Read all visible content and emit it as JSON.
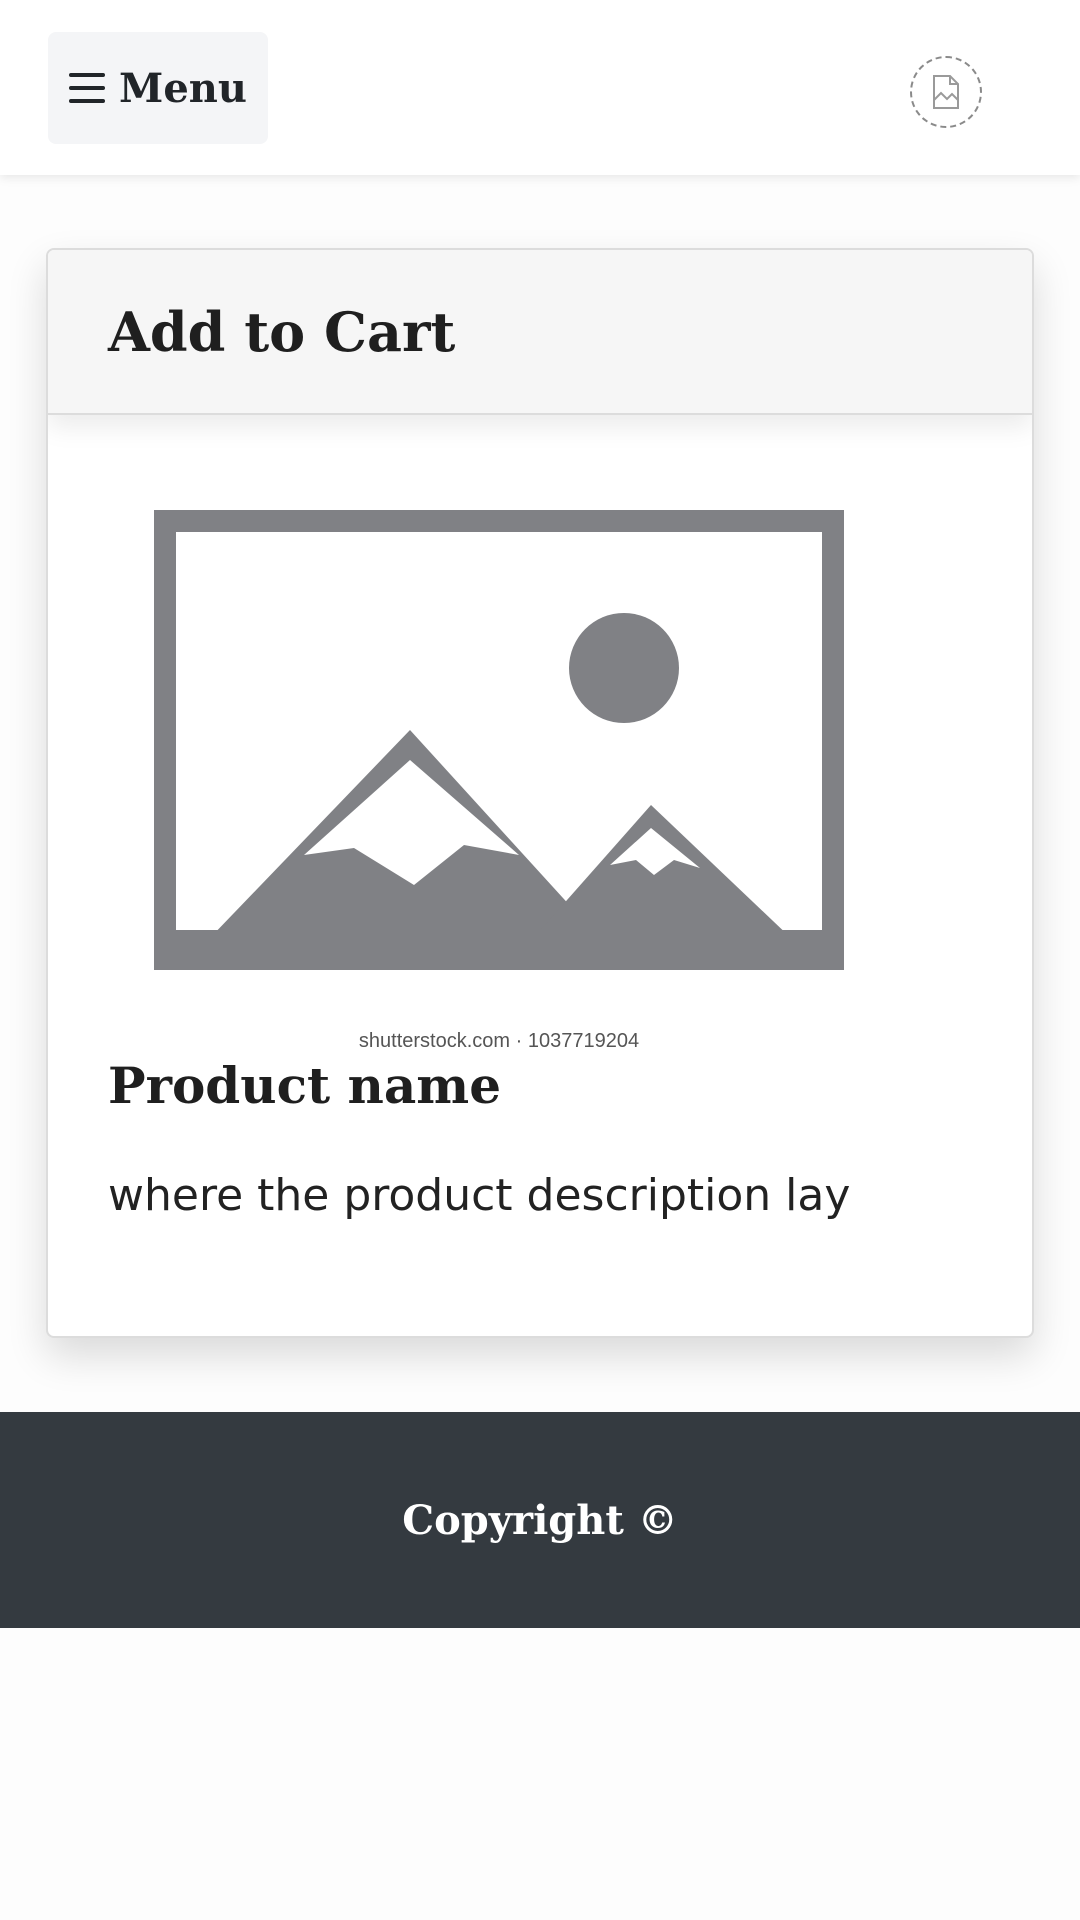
{
  "navbar": {
    "menu_label": "Menu",
    "menu_icon": "hamburger-icon",
    "avatar_icon": "broken-image-icon"
  },
  "card": {
    "title": "Add to Cart",
    "image": {
      "icon": "image-placeholder-icon",
      "caption": "shutterstock.com · 1037719204"
    },
    "product_name": "Product name",
    "product_description": "where the product description lay"
  },
  "footer": {
    "copyright": "Copyright ©"
  },
  "colors": {
    "footer_bg": "#343a40",
    "placeholder_gray": "#808185",
    "header_bg": "#f6f6f6"
  }
}
